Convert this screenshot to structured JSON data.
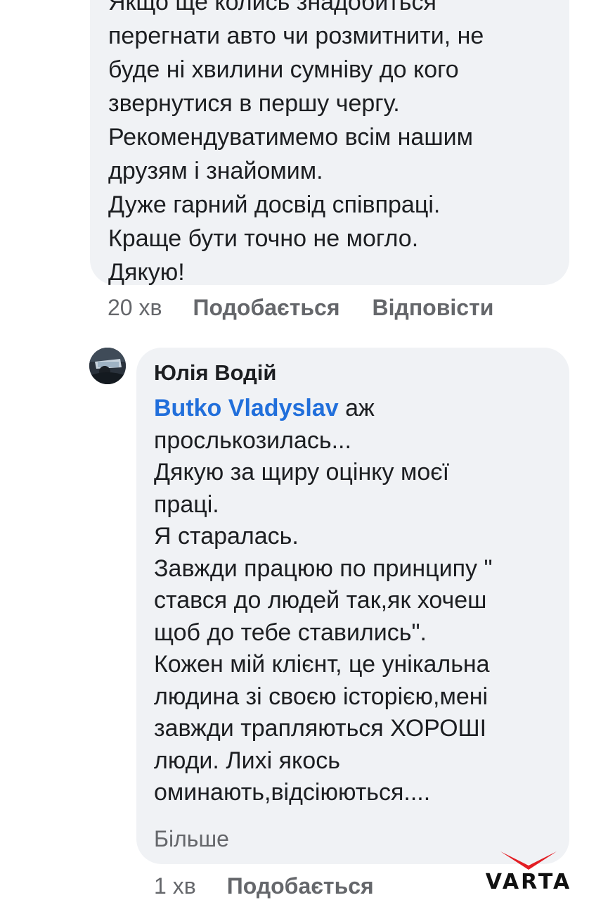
{
  "comment_1": {
    "lines": [
      "Якщо ще колись знадобиться",
      "перегнати авто чи розмитнити, не",
      "буде ні хвилини сумніву до кого",
      "звернутися в першу чергу.",
      "Рекомендуватимемо всім нашим",
      "друзям і знайомим.",
      "Дуже гарний досвід співпраці.",
      "Краще бути точно не могло.",
      "Дякую!"
    ],
    "time": "20 хв",
    "like_label": "Подобається",
    "reply_label": "Відповісти"
  },
  "comment_2": {
    "author": "Юлія Водій",
    "mention": "Butko Vladyslav",
    "first_line_rest": " аж",
    "lines": [
      "прослькозилась...",
      "Дякую за щиру оцінку моєї",
      "праці.",
      "Я старалась.",
      "Завжди працюю по принципу \"",
      "стався до людей так,як хочеш",
      "щоб до тебе ставились\".",
      "Кожен мій клієнт, це унікальна",
      "людина зі своєю історією,мені",
      "завжди трапляються ХОРОШІ",
      "люди. Лихі якось",
      "оминають,відсіюються...."
    ],
    "more_label": "Більше",
    "time": "1 хв",
    "like_label": "Подобається"
  },
  "watermark": {
    "text": "VARTA",
    "accent_color": "#e31e24"
  },
  "colors": {
    "bubble_bg": "#f0f2f5",
    "text": "#1c1e21",
    "secondary_text": "#65676b",
    "mention": "#216fdb"
  }
}
